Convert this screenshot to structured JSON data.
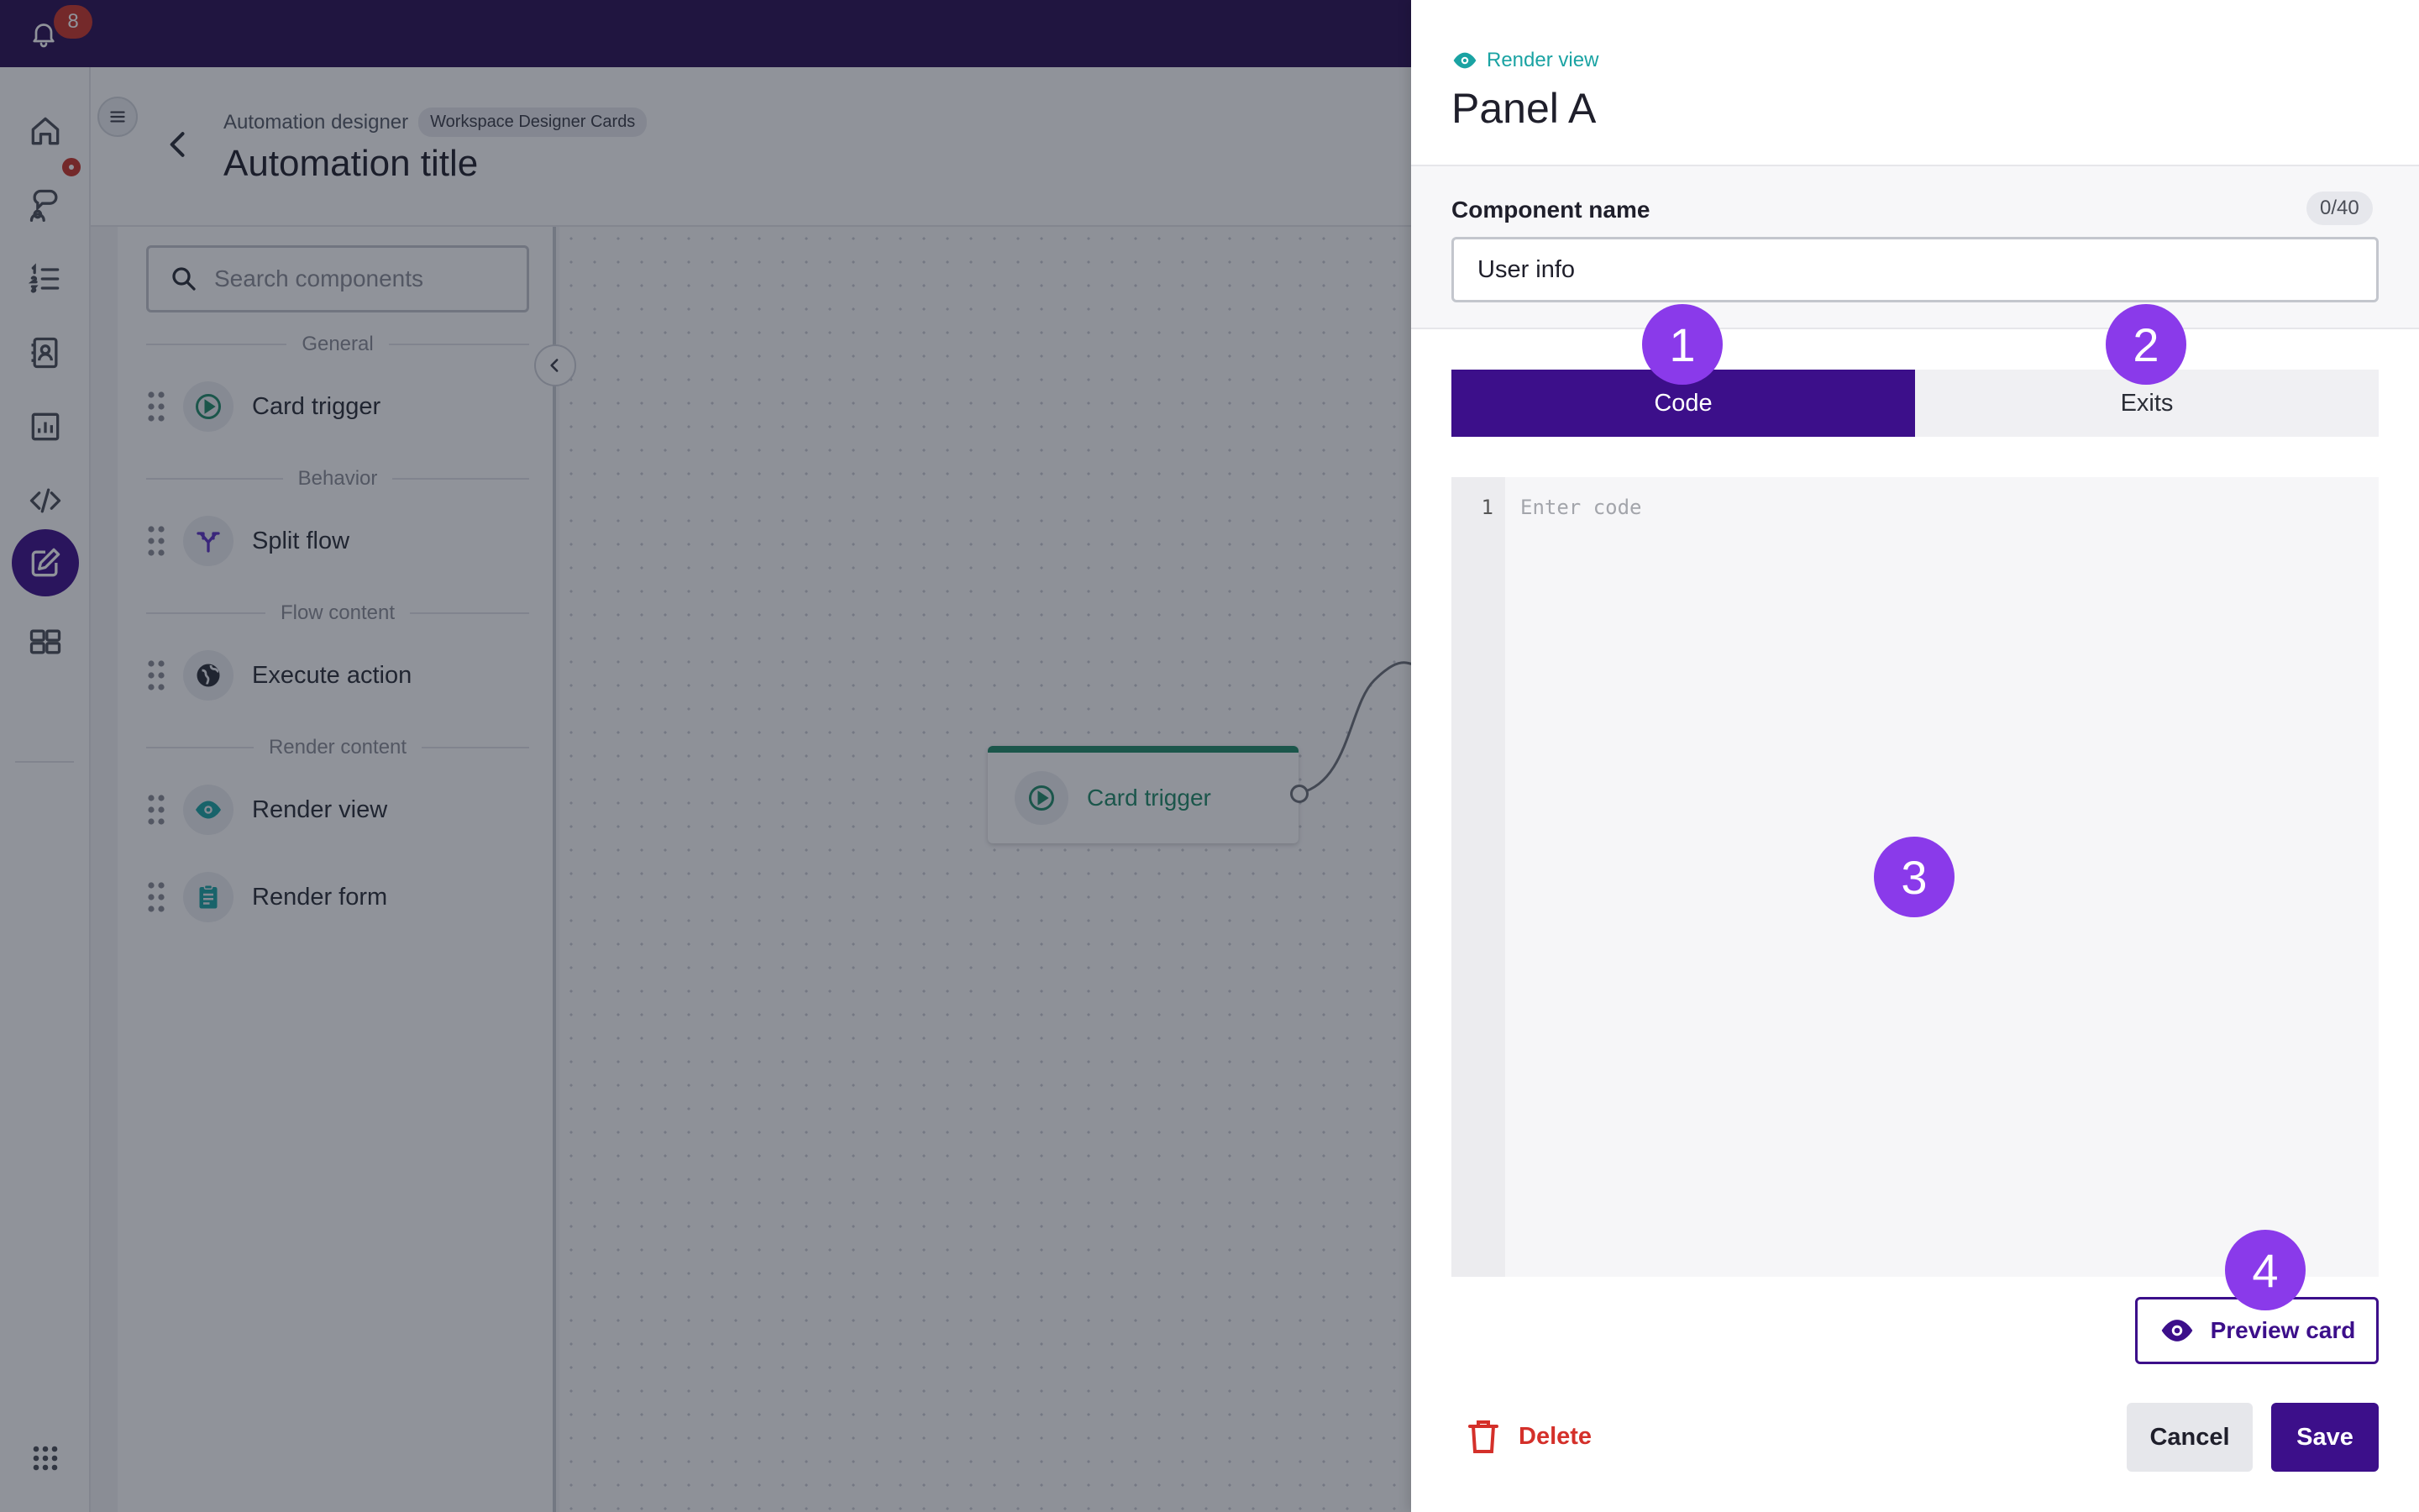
{
  "topbar": {
    "notification_count": "8"
  },
  "header": {
    "breadcrumb_label": "Automation designer",
    "breadcrumb_chip": "Workspace Designer Cards",
    "title": "Automation title"
  },
  "components": {
    "search_placeholder": "Search components",
    "sections": {
      "general": "General",
      "behavior": "Behavior",
      "flow_content": "Flow content",
      "render_content": "Render content"
    },
    "items": {
      "card_trigger": "Card trigger",
      "split_flow": "Split flow",
      "execute_action": "Execute action",
      "render_view": "Render view",
      "render_form": "Render form"
    }
  },
  "canvas": {
    "node_label": "Card trigger"
  },
  "drawer": {
    "type_label": "Render view",
    "title": "Panel A",
    "name_label": "Component name",
    "name_counter": "0/40",
    "name_value": "User info",
    "tabs": {
      "code": "Code",
      "exits": "Exits"
    },
    "editor": {
      "line_number": "1",
      "placeholder": "Enter code"
    },
    "preview_label": "Preview card",
    "delete_label": "Delete",
    "cancel_label": "Cancel",
    "save_label": "Save"
  },
  "steps": [
    "1",
    "2",
    "3",
    "4"
  ],
  "colors": {
    "topbar": "#290e54",
    "primary": "#3c0f8a",
    "step_badge": "#8a3aea",
    "trigger_green": "#1f8a68",
    "render_teal": "#1aa3a3",
    "danger": "#d4302a"
  }
}
